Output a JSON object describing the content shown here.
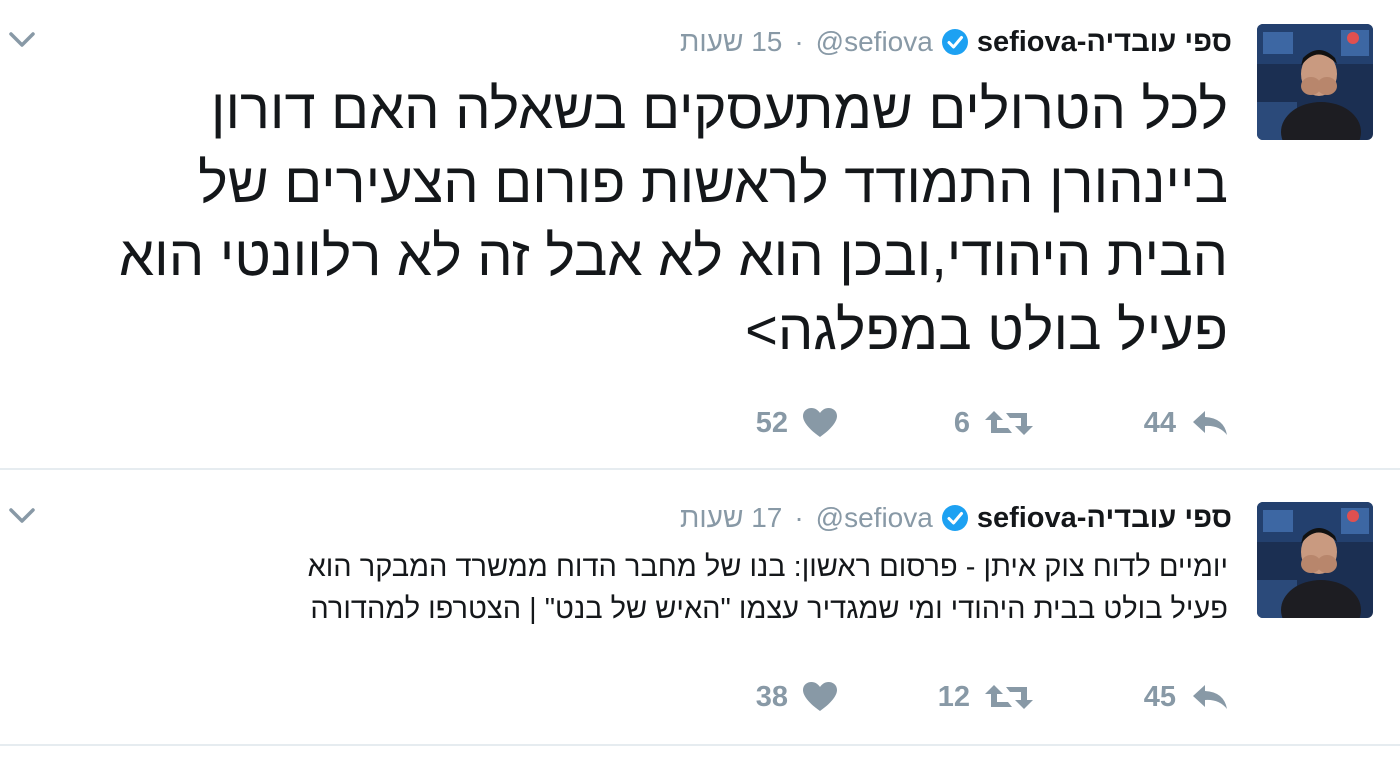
{
  "tweets": [
    {
      "display_name": "ספי עובדיה-sefiova",
      "handle": "@sefiova",
      "separator": "·",
      "time": "15 שעות",
      "text_lines": [
        "לכל הטרולים שמתעסקים בשאלה האם דורון",
        "ביינהורן התמודד לראשות פורום הצעירים של",
        "הבית היהודי,ובכן הוא לא אבל זה לא רלוונטי הוא",
        "פעיל בולט במפלגה>"
      ],
      "replies": "44",
      "retweets": "6",
      "likes": "52"
    },
    {
      "display_name": "ספי עובדיה-sefiova",
      "handle": "@sefiova",
      "separator": "·",
      "time": "17 שעות",
      "text_lines": [
        "יומיים לדוח צוק איתן - פרסום ראשון: בנו של מחבר הדוח ממשרד המבקר הוא",
        "פעיל בולט בבית היהודי ומי שמגדיר עצמו \"האיש של בנט\" | הצטרפו למהדורה"
      ],
      "replies": "45",
      "retweets": "12",
      "likes": "38"
    }
  ],
  "icons": {
    "verified": "verified-badge-icon",
    "reply": "reply-icon",
    "retweet": "retweet-icon",
    "like": "heart-icon",
    "more": "chevron-down-icon"
  },
  "colors": {
    "verified": "#1da1f2",
    "muted": "#8899a6",
    "text": "#14171a",
    "divider": "#e6ecf0"
  }
}
